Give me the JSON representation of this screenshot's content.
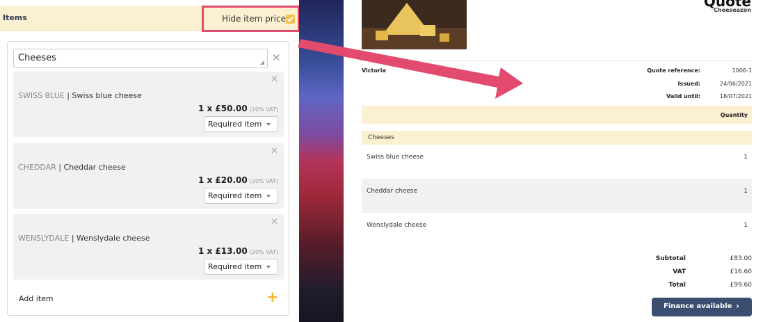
{
  "editor": {
    "items_title": "Items",
    "hide_prices": {
      "label": "Hide item prices",
      "checked": true
    },
    "group": {
      "name": "Cheeses",
      "items": [
        {
          "code": "SWISS BLUE",
          "separator": "|",
          "name": "Swiss blue cheese",
          "price": "1 x £50.00",
          "vat": "(20% VAT)",
          "requirement": "Required item"
        },
        {
          "code": "CHEDDAR",
          "separator": "|",
          "name": "Cheddar cheese",
          "price": "1 x £20.00",
          "vat": "(20% VAT)",
          "requirement": "Required item"
        },
        {
          "code": "WENSLYDALE",
          "separator": "|",
          "name": "Wenslydale cheese",
          "price": "1 x £13.00",
          "vat": "(20% VAT)",
          "requirement": "Required item"
        }
      ],
      "add_item_label": "Add item"
    }
  },
  "quote": {
    "title": "Quote",
    "company": "Cheeseazon",
    "customer": "Victoria",
    "meta": [
      {
        "label": "Quote reference:",
        "value": "1006-1"
      },
      {
        "label": "Issued:",
        "value": "24/06/2021"
      },
      {
        "label": "Valid until:",
        "value": "18/07/2021"
      }
    ],
    "table_header_quantity": "Quantity",
    "section": "Cheeses",
    "rows": [
      {
        "name": "Swiss blue cheese",
        "qty": "1"
      },
      {
        "name": "Cheddar cheese",
        "qty": "1"
      },
      {
        "name": "Wenslydale cheese",
        "qty": "1"
      }
    ],
    "totals": [
      {
        "label": "Subtotal",
        "value": "£83.00"
      },
      {
        "label": "VAT",
        "value": "£16.60"
      },
      {
        "label": "Total",
        "value": "£99.60"
      }
    ],
    "finance_button": "Finance available"
  },
  "icons": {
    "remove": "close-icon",
    "add": "plus-icon",
    "caret": "chevron-down-icon",
    "finance": "chevron-right-icon"
  },
  "colors": {
    "highlight_bar": "#fbf1d2",
    "annotation": "#e24a6e",
    "checkbox": "#f1c24a",
    "add_plus": "#f1b731",
    "finance_button": "#3a4e70"
  }
}
